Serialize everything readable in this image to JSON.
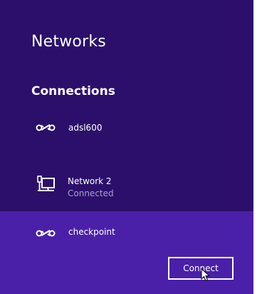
{
  "panel": {
    "title": "Networks",
    "section_heading": "Connections"
  },
  "networks": [
    {
      "name": "adsl600",
      "status": "",
      "icon": "wifi-link-icon"
    },
    {
      "name": "Network  2",
      "status": "Connected",
      "icon": "wired-network-icon"
    },
    {
      "name": "checkpoint",
      "status": "",
      "icon": "wifi-link-icon",
      "selected": true
    }
  ],
  "actions": {
    "connect_label": "Connect"
  },
  "colors": {
    "panel_bg": "#2b0f6b",
    "selected_bg": "#4a20a8",
    "text": "#ffffff",
    "status_text": "#a9a0c9"
  },
  "icons": {
    "wifi": "wifi-link-icon",
    "wired": "wired-network-icon",
    "cursor": "mouse-pointer-icon"
  }
}
